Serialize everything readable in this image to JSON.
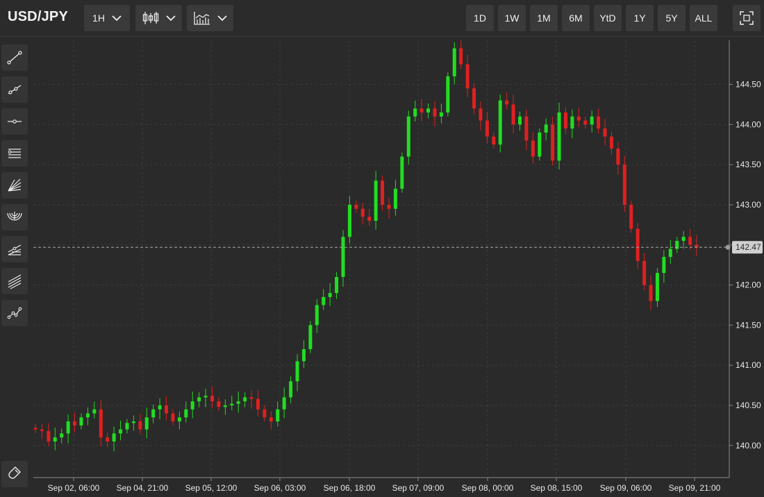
{
  "header": {
    "symbol": "USD/JPY",
    "interval": "1H",
    "ranges": [
      "1D",
      "1W",
      "1M",
      "6M",
      "YtD",
      "1Y",
      "5Y",
      "ALL"
    ]
  },
  "sidebar": {
    "tools": [
      "trend-line-icon",
      "ray-icon",
      "horizontal-line-icon",
      "parallel-channel-icon",
      "fan-icon",
      "arc-icon",
      "pitchfork-icon",
      "fib-lines-icon",
      "path-icon"
    ],
    "bottom_tool": "magnet-icon"
  },
  "colors": {
    "up": "#22dd22",
    "down": "#e02020",
    "background": "#2a2a2a",
    "grid": "#3d3d3d"
  },
  "chart_data": {
    "type": "candlestick",
    "symbol": "USD/JPY",
    "interval": "1H",
    "last_price": "142.47",
    "ylim": [
      139.6,
      145.05
    ],
    "y_ticks": [
      "140.00",
      "140.50",
      "141.00",
      "141.50",
      "142.00",
      "142.50",
      "143.00",
      "143.50",
      "144.00",
      "144.50"
    ],
    "x_ticks": [
      "Sep 02, 06:00",
      "Sep 04, 21:00",
      "Sep 05, 12:00",
      "Sep 06, 03:00",
      "Sep 06, 18:00",
      "Sep 07, 09:00",
      "Sep 08, 00:00",
      "Sep 08, 15:00",
      "Sep 09, 06:00",
      "Sep 09, 21:00"
    ],
    "closes": [
      140.2,
      140.18,
      140.05,
      140.1,
      140.15,
      140.3,
      140.25,
      140.35,
      140.4,
      140.45,
      140.1,
      140.05,
      140.15,
      140.2,
      140.28,
      140.3,
      140.2,
      140.35,
      140.45,
      140.5,
      140.4,
      140.3,
      140.35,
      140.45,
      140.55,
      140.6,
      140.62,
      140.55,
      140.48,
      140.5,
      140.52,
      140.55,
      140.6,
      140.58,
      140.45,
      140.35,
      140.3,
      140.45,
      140.6,
      140.8,
      141.05,
      141.2,
      141.5,
      141.75,
      141.85,
      141.9,
      142.1,
      142.6,
      143.0,
      142.95,
      142.85,
      142.8,
      143.3,
      143.0,
      142.95,
      143.2,
      143.6,
      144.1,
      144.2,
      144.15,
      144.2,
      144.1,
      144.15,
      144.6,
      144.95,
      144.75,
      144.45,
      144.2,
      144.05,
      143.85,
      143.75,
      144.3,
      144.25,
      144.0,
      144.1,
      143.8,
      143.6,
      143.9,
      144.0,
      143.55,
      144.15,
      143.95,
      144.1,
      144.05,
      144.0,
      144.1,
      143.95,
      143.85,
      143.7,
      143.5,
      143.0,
      142.7,
      142.3,
      142.0,
      141.8,
      142.15,
      142.35,
      142.45,
      142.55,
      142.6,
      142.5,
      142.47
    ]
  }
}
